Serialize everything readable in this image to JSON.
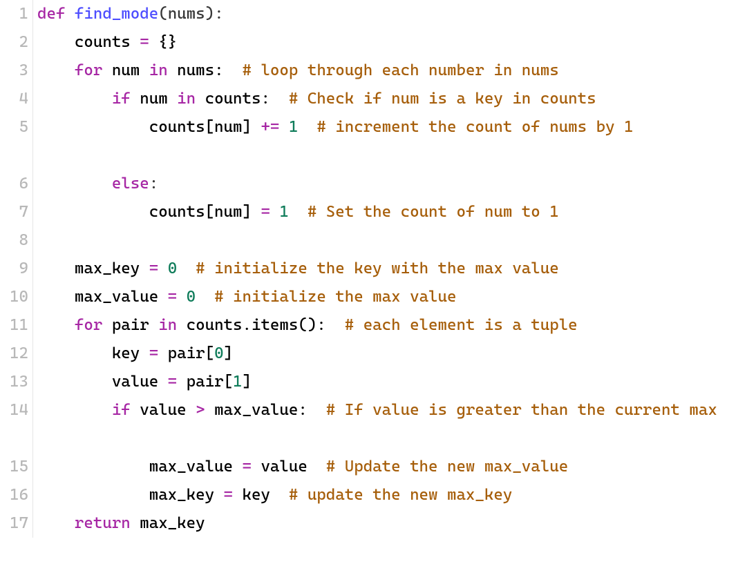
{
  "code": {
    "lines": [
      {
        "n": "1",
        "tokens": [
          {
            "cls": "tok-keyword",
            "t": "def"
          },
          {
            "cls": "",
            "t": " "
          },
          {
            "cls": "tok-funcname",
            "t": "find_mode"
          },
          {
            "cls": "tok-punct",
            "t": "(nums):"
          }
        ]
      },
      {
        "n": "2",
        "tokens": [
          {
            "cls": "",
            "t": "    counts "
          },
          {
            "cls": "tok-op",
            "t": "="
          },
          {
            "cls": "",
            "t": " {}"
          }
        ]
      },
      {
        "n": "3",
        "tokens": [
          {
            "cls": "",
            "t": "    "
          },
          {
            "cls": "tok-keyword",
            "t": "for"
          },
          {
            "cls": "",
            "t": " num "
          },
          {
            "cls": "tok-keyword",
            "t": "in"
          },
          {
            "cls": "",
            "t": " nums:  "
          },
          {
            "cls": "tok-comment",
            "t": "# loop through each number in nums"
          }
        ]
      },
      {
        "n": "4",
        "tokens": [
          {
            "cls": "",
            "t": "        "
          },
          {
            "cls": "tok-keyword",
            "t": "if"
          },
          {
            "cls": "",
            "t": " num "
          },
          {
            "cls": "tok-keyword",
            "t": "in"
          },
          {
            "cls": "",
            "t": " counts:  "
          },
          {
            "cls": "tok-comment",
            "t": "# Check if num is a key in counts"
          }
        ]
      },
      {
        "n": "5",
        "wrap": true,
        "tokens": [
          {
            "cls": "",
            "t": "            counts[num] "
          },
          {
            "cls": "tok-op",
            "t": "+="
          },
          {
            "cls": "",
            "t": " "
          },
          {
            "cls": "tok-number",
            "t": "1"
          },
          {
            "cls": "",
            "t": "  "
          },
          {
            "cls": "tok-comment",
            "t": "# increment the count of nums by 1"
          }
        ]
      },
      {
        "n": "6",
        "tokens": [
          {
            "cls": "",
            "t": "        "
          },
          {
            "cls": "tok-keyword",
            "t": "else"
          },
          {
            "cls": "tok-punct",
            "t": ":"
          }
        ]
      },
      {
        "n": "7",
        "tokens": [
          {
            "cls": "",
            "t": "            counts[num] "
          },
          {
            "cls": "tok-op",
            "t": "="
          },
          {
            "cls": "",
            "t": " "
          },
          {
            "cls": "tok-number",
            "t": "1"
          },
          {
            "cls": "",
            "t": "  "
          },
          {
            "cls": "tok-comment",
            "t": "# Set the count of num to 1"
          }
        ]
      },
      {
        "n": "8",
        "tokens": [
          {
            "cls": "",
            "t": " "
          }
        ]
      },
      {
        "n": "9",
        "tokens": [
          {
            "cls": "",
            "t": "    max_key "
          },
          {
            "cls": "tok-op",
            "t": "="
          },
          {
            "cls": "",
            "t": " "
          },
          {
            "cls": "tok-number",
            "t": "0"
          },
          {
            "cls": "",
            "t": "  "
          },
          {
            "cls": "tok-comment",
            "t": "# initialize the key with the max value"
          }
        ]
      },
      {
        "n": "10",
        "tokens": [
          {
            "cls": "",
            "t": "    max_value "
          },
          {
            "cls": "tok-op",
            "t": "="
          },
          {
            "cls": "",
            "t": " "
          },
          {
            "cls": "tok-number",
            "t": "0"
          },
          {
            "cls": "",
            "t": "  "
          },
          {
            "cls": "tok-comment",
            "t": "# initialize the max value"
          }
        ]
      },
      {
        "n": "11",
        "tokens": [
          {
            "cls": "",
            "t": "    "
          },
          {
            "cls": "tok-keyword",
            "t": "for"
          },
          {
            "cls": "",
            "t": " pair "
          },
          {
            "cls": "tok-keyword",
            "t": "in"
          },
          {
            "cls": "",
            "t": " counts.items():  "
          },
          {
            "cls": "tok-comment",
            "t": "# each element is a tuple"
          }
        ]
      },
      {
        "n": "12",
        "tokens": [
          {
            "cls": "",
            "t": "        key "
          },
          {
            "cls": "tok-op",
            "t": "="
          },
          {
            "cls": "",
            "t": " pair["
          },
          {
            "cls": "tok-number",
            "t": "0"
          },
          {
            "cls": "",
            "t": "]"
          }
        ]
      },
      {
        "n": "13",
        "tokens": [
          {
            "cls": "",
            "t": "        value "
          },
          {
            "cls": "tok-op",
            "t": "="
          },
          {
            "cls": "",
            "t": " pair["
          },
          {
            "cls": "tok-number",
            "t": "1"
          },
          {
            "cls": "",
            "t": "]"
          }
        ]
      },
      {
        "n": "14",
        "wrap": true,
        "tokens": [
          {
            "cls": "",
            "t": "        "
          },
          {
            "cls": "tok-keyword",
            "t": "if"
          },
          {
            "cls": "",
            "t": " value "
          },
          {
            "cls": "tok-op",
            "t": ">"
          },
          {
            "cls": "",
            "t": " max_value:  "
          },
          {
            "cls": "tok-comment",
            "t": "# If value is greater than the current max"
          }
        ]
      },
      {
        "n": "15",
        "tokens": [
          {
            "cls": "",
            "t": "            max_value "
          },
          {
            "cls": "tok-op",
            "t": "="
          },
          {
            "cls": "",
            "t": " value  "
          },
          {
            "cls": "tok-comment",
            "t": "# Update the new max_value"
          }
        ]
      },
      {
        "n": "16",
        "tokens": [
          {
            "cls": "",
            "t": "            max_key "
          },
          {
            "cls": "tok-op",
            "t": "="
          },
          {
            "cls": "",
            "t": " key  "
          },
          {
            "cls": "tok-comment",
            "t": "# update the new max_key"
          }
        ]
      },
      {
        "n": "17",
        "tokens": [
          {
            "cls": "",
            "t": "    "
          },
          {
            "cls": "tok-keyword",
            "t": "return"
          },
          {
            "cls": "",
            "t": " max_key"
          }
        ]
      }
    ]
  }
}
